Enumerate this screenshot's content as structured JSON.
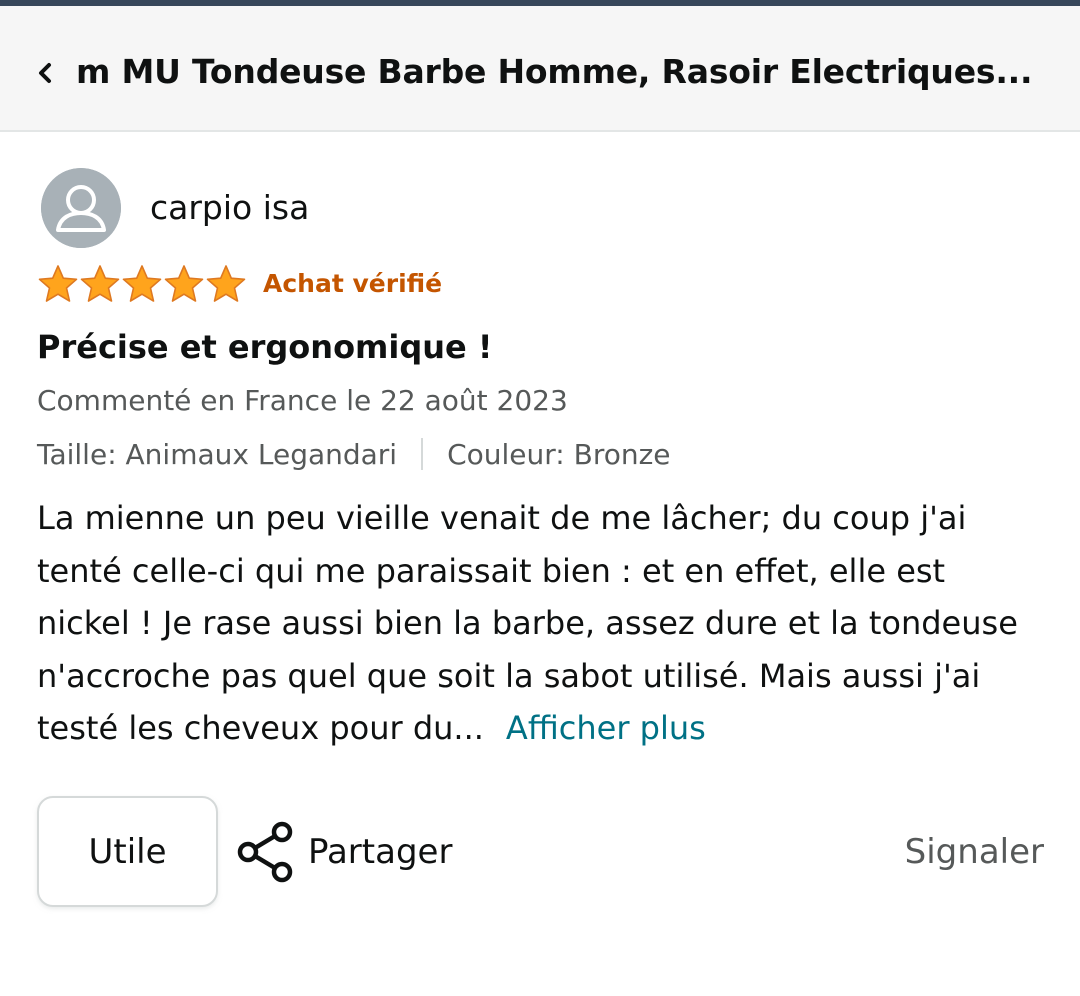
{
  "header": {
    "title": "m MU Tondeuse Barbe Homme, Rasoir Electriques..."
  },
  "review": {
    "reviewer_name": "carpio isa",
    "rating": 5,
    "rating_max": 5,
    "verified_label": "Achat vérifié",
    "title": "Précise et ergonomique !",
    "date_line": "Commenté en France le 22 août 2023",
    "size_label": "Taille: Animaux Legandari",
    "color_label": "Couleur: Bronze",
    "body": "La mienne un peu vieille venait de me lâcher; du coup j'ai tenté celle-ci qui me paraissait bien : et en effet, elle est nickel ! Je rase aussi bien la barbe, assez dure et la tondeuse n'accroche pas quel que soit la sabot utilisé. Mais aussi j'ai testé les cheveux pour du...",
    "more_label": "Afficher plus"
  },
  "actions": {
    "helpful_label": "Utile",
    "share_label": "Partager",
    "report_label": "Signaler"
  },
  "icons": {
    "back": "chevron-left-icon",
    "avatar": "user-avatar-icon",
    "star": "star-icon",
    "share": "share-icon"
  },
  "colors": {
    "star": "#ffa41c",
    "verified": "#c45500",
    "link": "#007185",
    "secondary_text": "#565959",
    "header_bg": "#f6f6f6"
  }
}
